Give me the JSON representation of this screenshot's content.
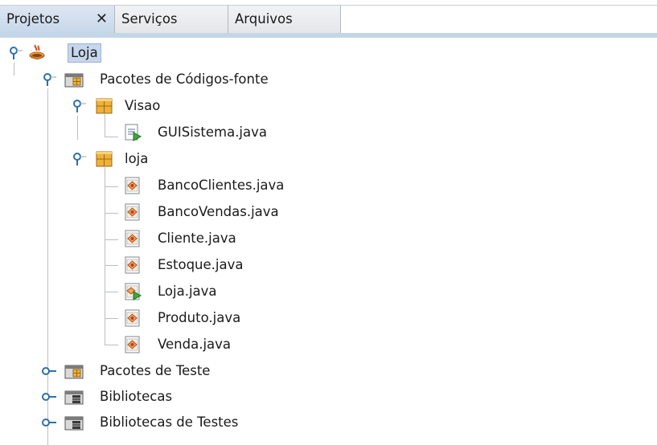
{
  "tabs": {
    "projects": "Projetos",
    "close_symbol": "✕",
    "services": "Serviços",
    "files": "Arquivos"
  },
  "tree": {
    "root": {
      "label": "Loja",
      "icon": "java-project-icon",
      "expanded": true,
      "selected": true
    },
    "source_packages": {
      "label": "Pacotes de Códigos-fonte",
      "icon": "source-folder-icon",
      "expanded": true
    },
    "pkg_visao": {
      "label": "Visao",
      "icon": "package-icon",
      "expanded": true,
      "files": [
        {
          "label": "GUISistema.java",
          "icon": "java-form-icon"
        }
      ]
    },
    "pkg_loja": {
      "label": "loja",
      "icon": "package-icon",
      "expanded": true,
      "files": [
        {
          "label": "BancoClientes.java",
          "icon": "java-class-icon"
        },
        {
          "label": "BancoVendas.java",
          "icon": "java-class-icon"
        },
        {
          "label": "Cliente.java",
          "icon": "java-class-icon"
        },
        {
          "label": "Estoque.java",
          "icon": "java-class-icon"
        },
        {
          "label": "Loja.java",
          "icon": "java-main-class-icon"
        },
        {
          "label": "Produto.java",
          "icon": "java-class-icon"
        },
        {
          "label": "Venda.java",
          "icon": "java-class-icon"
        }
      ]
    },
    "test_packages": {
      "label": "Pacotes de Teste",
      "icon": "test-folder-icon",
      "expanded": false
    },
    "libraries": {
      "label": "Bibliotecas",
      "icon": "library-icon",
      "expanded": false
    },
    "test_libraries": {
      "label": "Bibliotecas de Testes",
      "icon": "library-icon",
      "expanded": false
    }
  },
  "colors": {
    "selection": "#c6d6ec",
    "tab_active": "#c7d7ea",
    "package": "#f0b13a",
    "tree_line": "#b9bec5"
  }
}
